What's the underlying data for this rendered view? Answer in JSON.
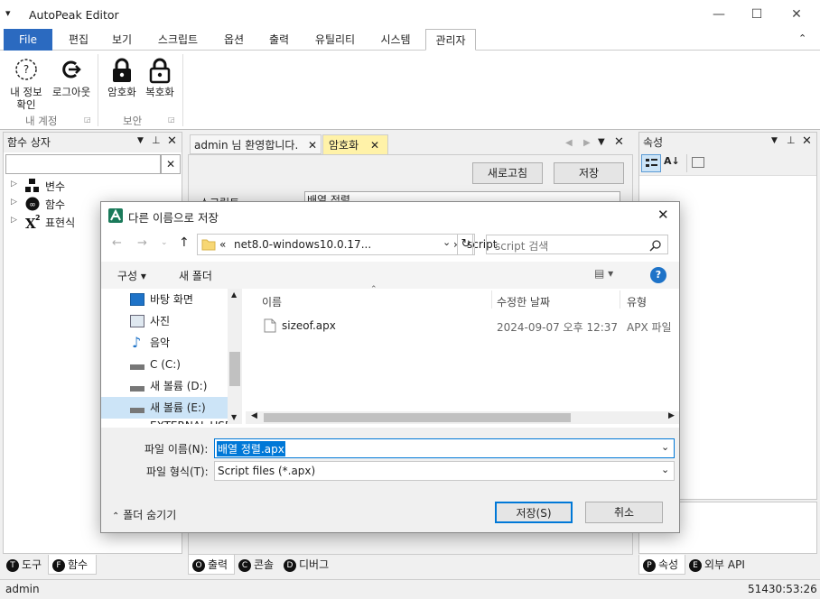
{
  "app": {
    "title": "AutoPeak Editor",
    "menu_glyph": "▾"
  },
  "window_controls": {
    "minimize": "—",
    "maximize": "☐",
    "close": "✕"
  },
  "ribbon_tabs": [
    "File",
    "편집",
    "보기",
    "스크립트",
    "옵션",
    "출력",
    "유틸리티",
    "시스템",
    "관리자"
  ],
  "ribbon_collapse": "⌃",
  "ribbon": {
    "my_info_l1": "내 정보",
    "my_info_l2": "확인",
    "logout": "로그아웃",
    "encrypt": "암호화",
    "decrypt": "복호화",
    "group_account": "내 계정",
    "group_security": "보안"
  },
  "left_panel": {
    "title": "함수 상자",
    "search_value": "",
    "clear": "✕",
    "tree": [
      "변수",
      "함수",
      "표현식"
    ]
  },
  "doc_tabs": {
    "tab1": "admin 님 환영합니다.",
    "tab2": "암호화"
  },
  "doc": {
    "refresh": "새로고침",
    "save": "저장",
    "script_label": "스크립트",
    "script_value": "배열 정렬"
  },
  "right_panel": {
    "title": "속성"
  },
  "bottom_tabs_left": [
    {
      "badge": "T",
      "label": "도구"
    },
    {
      "badge": "F",
      "label": "함수"
    }
  ],
  "bottom_tabs_mid": [
    {
      "badge": "O",
      "label": "출력"
    },
    {
      "badge": "C",
      "label": "콘솔"
    },
    {
      "badge": "D",
      "label": "디버그"
    }
  ],
  "bottom_tabs_right": [
    {
      "badge": "P",
      "label": "속성"
    },
    {
      "badge": "E",
      "label": "외부 API"
    }
  ],
  "status": {
    "user": "admin",
    "position": "51430:53:26"
  },
  "dialog": {
    "title": "다른 이름으로 저장",
    "close": "✕",
    "path_prefix": "«",
    "path_part1": "net8.0-windows10.0.17...",
    "path_sep": "›",
    "path_part2": "script",
    "search_placeholder": "script 검색",
    "organize": "구성 ▾",
    "new_folder": "새 폴더",
    "help": "?",
    "nav_items": [
      "바탕 화면",
      "사진",
      "음악",
      "C (C:)",
      "새 볼륨 (D:)",
      "새 볼륨 (E:)",
      "EXTERNAL USB"
    ],
    "columns": {
      "name": "이름",
      "modified": "수정한 날짜",
      "type": "유형"
    },
    "files": [
      {
        "name": "sizeof.apx",
        "modified": "2024-09-07 오후 12:37",
        "type": "APX 파일"
      }
    ],
    "filename_label": "파일 이름(N):",
    "filename_value": "배열 정렬.apx",
    "filetype_label": "파일 형식(T):",
    "filetype_value": "Script files (*.apx)",
    "hide_folders": "폴더 숨기기",
    "save_button": "저장(S)",
    "cancel_button": "취소"
  },
  "colors": {
    "accent": "#2b6ac0",
    "selection": "#cce4f7",
    "highlight_tab": "#fff2a8"
  }
}
